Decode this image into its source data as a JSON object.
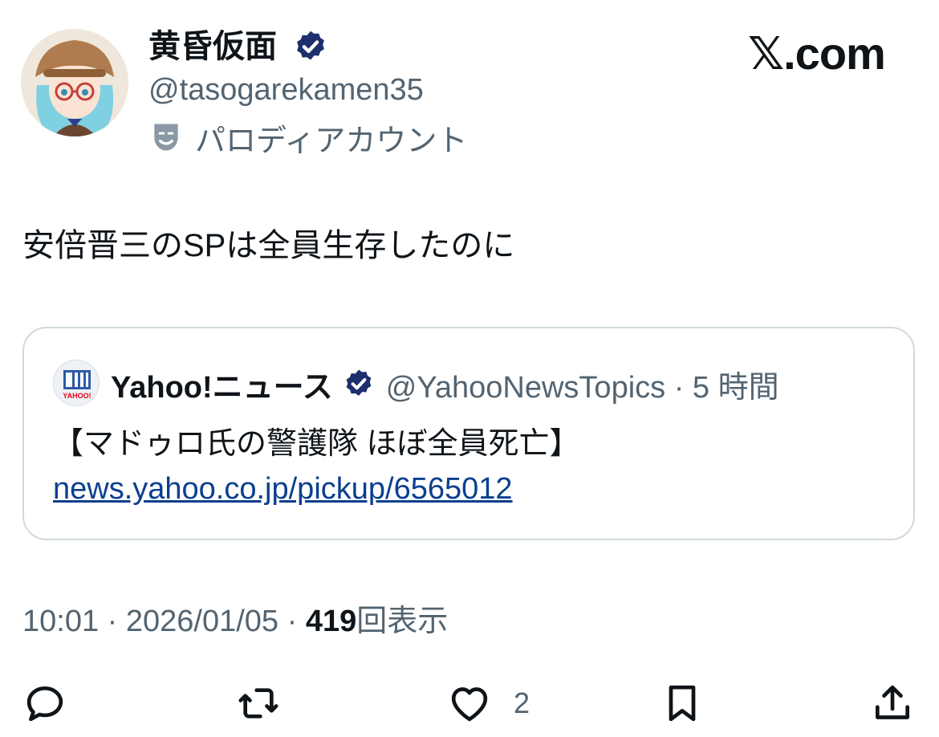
{
  "author": {
    "display_name": "黄昏仮面",
    "handle": "@tasogarekamen35",
    "parody_label": "パロディアカウント",
    "verified_color": "#1d2f6d"
  },
  "brand": "𝕏.com",
  "tweet": {
    "text": "安倍晋三のSPは全員生存したのに"
  },
  "quote": {
    "name": "Yahoo!ニュース",
    "meta": "@YahooNewsTopics · 5 時間",
    "text": "【マドゥロ氏の警護隊 ほぼ全員死亡】",
    "link": "news.yahoo.co.jp/pickup/6565012",
    "logo_text": "YAHOO!"
  },
  "meta": {
    "time_date": "10:01 · 2026/01/05 · ",
    "views_count": "419",
    "views_label": "回表示"
  },
  "actions": {
    "reply_icon": "reply-icon",
    "retweet_icon": "retweet-icon",
    "like_icon": "heart-icon",
    "like_count": "2",
    "bookmark_icon": "bookmark-icon",
    "share_icon": "share-icon"
  }
}
